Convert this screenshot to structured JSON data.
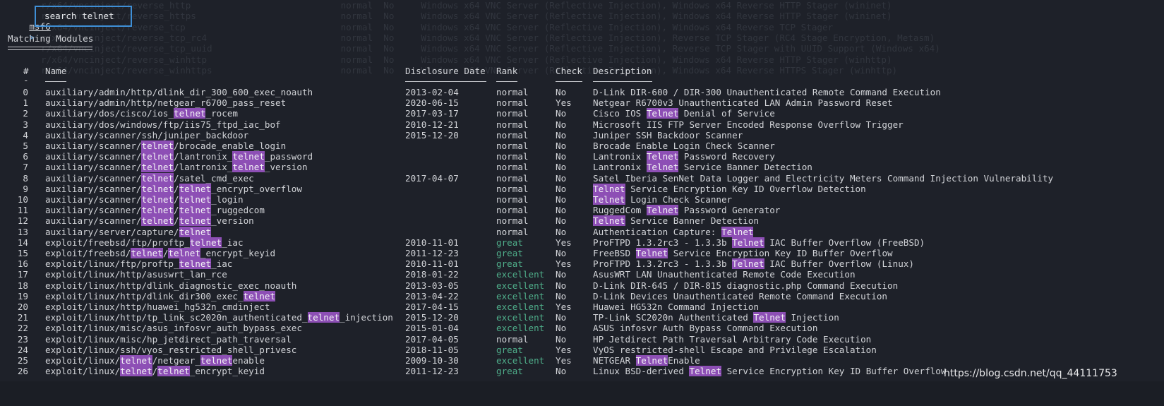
{
  "prompt": {
    "name": "msf6",
    "arrow": ">",
    "command": "search telnet"
  },
  "section_title": "Matching Modules",
  "columns": {
    "num": "#",
    "name": "Name",
    "date": "Disclosure Date",
    "rank": "Rank",
    "check": "Check",
    "description": "Description",
    "num_rule": "-"
  },
  "highlight_term": "telnet",
  "rows": [
    {
      "num": "0",
      "name": "auxiliary/admin/http/dlink_dir_300_600_exec_noauth",
      "date": "2013-02-04",
      "rank": "normal",
      "check": "No",
      "description": "D-Link DIR-600 / DIR-300 Unauthenticated Remote Command Execution"
    },
    {
      "num": "1",
      "name": "auxiliary/admin/http/netgear_r6700_pass_reset",
      "date": "2020-06-15",
      "rank": "normal",
      "check": "Yes",
      "description": "Netgear R6700v3 Unauthenticated LAN Admin Password Reset"
    },
    {
      "num": "2",
      "name": "auxiliary/dos/cisco/ios_telnet_rocem",
      "date": "2017-03-17",
      "rank": "normal",
      "check": "No",
      "description": "Cisco IOS Telnet Denial of Service"
    },
    {
      "num": "3",
      "name": "auxiliary/dos/windows/ftp/iis75_ftpd_iac_bof",
      "date": "2010-12-21",
      "rank": "normal",
      "check": "No",
      "description": "Microsoft IIS FTP Server Encoded Response Overflow Trigger"
    },
    {
      "num": "4",
      "name": "auxiliary/scanner/ssh/juniper_backdoor",
      "date": "2015-12-20",
      "rank": "normal",
      "check": "No",
      "description": "Juniper SSH Backdoor Scanner"
    },
    {
      "num": "5",
      "name": "auxiliary/scanner/telnet/brocade_enable_login",
      "date": "",
      "rank": "normal",
      "check": "No",
      "description": "Brocade Enable Login Check Scanner"
    },
    {
      "num": "6",
      "name": "auxiliary/scanner/telnet/lantronix_telnet_password",
      "date": "",
      "rank": "normal",
      "check": "No",
      "description": "Lantronix Telnet Password Recovery"
    },
    {
      "num": "7",
      "name": "auxiliary/scanner/telnet/lantronix_telnet_version",
      "date": "",
      "rank": "normal",
      "check": "No",
      "description": "Lantronix Telnet Service Banner Detection"
    },
    {
      "num": "8",
      "name": "auxiliary/scanner/telnet/satel_cmd_exec",
      "date": "2017-04-07",
      "rank": "normal",
      "check": "No",
      "description": "Satel Iberia SenNet Data Logger and Electricity Meters Command Injection Vulnerability"
    },
    {
      "num": "9",
      "name": "auxiliary/scanner/telnet/telnet_encrypt_overflow",
      "date": "",
      "rank": "normal",
      "check": "No",
      "description": "Telnet Service Encryption Key ID Overflow Detection"
    },
    {
      "num": "10",
      "name": "auxiliary/scanner/telnet/telnet_login",
      "date": "",
      "rank": "normal",
      "check": "No",
      "description": "Telnet Login Check Scanner"
    },
    {
      "num": "11",
      "name": "auxiliary/scanner/telnet/telnet_ruggedcom",
      "date": "",
      "rank": "normal",
      "check": "No",
      "description": "RuggedCom Telnet Password Generator"
    },
    {
      "num": "12",
      "name": "auxiliary/scanner/telnet/telnet_version",
      "date": "",
      "rank": "normal",
      "check": "No",
      "description": "Telnet Service Banner Detection"
    },
    {
      "num": "13",
      "name": "auxiliary/server/capture/telnet",
      "date": "",
      "rank": "normal",
      "check": "No",
      "description": "Authentication Capture: Telnet"
    },
    {
      "num": "14",
      "name": "exploit/freebsd/ftp/proftp_telnet_iac",
      "date": "2010-11-01",
      "rank": "great",
      "check": "Yes",
      "description": "ProFTPD 1.3.2rc3 - 1.3.3b Telnet IAC Buffer Overflow (FreeBSD)"
    },
    {
      "num": "15",
      "name": "exploit/freebsd/telnet/telnet_encrypt_keyid",
      "date": "2011-12-23",
      "rank": "great",
      "check": "No",
      "description": "FreeBSD Telnet Service Encryption Key ID Buffer Overflow"
    },
    {
      "num": "16",
      "name": "exploit/linux/ftp/proftp_telnet_iac",
      "date": "2010-11-01",
      "rank": "great",
      "check": "Yes",
      "description": "ProFTPD 1.3.2rc3 - 1.3.3b Telnet IAC Buffer Overflow (Linux)"
    },
    {
      "num": "17",
      "name": "exploit/linux/http/asuswrt_lan_rce",
      "date": "2018-01-22",
      "rank": "excellent",
      "check": "No",
      "description": "AsusWRT LAN Unauthenticated Remote Code Execution"
    },
    {
      "num": "18",
      "name": "exploit/linux/http/dlink_diagnostic_exec_noauth",
      "date": "2013-03-05",
      "rank": "excellent",
      "check": "No",
      "description": "D-Link DIR-645 / DIR-815 diagnostic.php Command Execution"
    },
    {
      "num": "19",
      "name": "exploit/linux/http/dlink_dir300_exec_telnet",
      "date": "2013-04-22",
      "rank": "excellent",
      "check": "No",
      "description": "D-Link Devices Unauthenticated Remote Command Execution"
    },
    {
      "num": "20",
      "name": "exploit/linux/http/huawei_hg532n_cmdinject",
      "date": "2017-04-15",
      "rank": "excellent",
      "check": "Yes",
      "description": "Huawei HG532n Command Injection"
    },
    {
      "num": "21",
      "name": "exploit/linux/http/tp_link_sc2020n_authenticated_telnet_injection",
      "date": "2015-12-20",
      "rank": "excellent",
      "check": "No",
      "description": "TP-Link SC2020n Authenticated Telnet Injection"
    },
    {
      "num": "22",
      "name": "exploit/linux/misc/asus_infosvr_auth_bypass_exec",
      "date": "2015-01-04",
      "rank": "excellent",
      "check": "No",
      "description": "ASUS infosvr Auth Bypass Command Execution"
    },
    {
      "num": "23",
      "name": "exploit/linux/misc/hp_jetdirect_path_traversal",
      "date": "2017-04-05",
      "rank": "normal",
      "check": "No",
      "description": "HP Jetdirect Path Traversal Arbitrary Code Execution"
    },
    {
      "num": "24",
      "name": "exploit/linux/ssh/vyos_restricted_shell_privesc",
      "date": "2018-11-05",
      "rank": "great",
      "check": "Yes",
      "description": "VyOS restricted-shell Escape and Privilege Escalation"
    },
    {
      "num": "25",
      "name": "exploit/linux/telnet/netgear_telnetenable",
      "date": "2009-10-30",
      "rank": "excellent",
      "check": "Yes",
      "description": "NETGEAR TelnetEnable"
    },
    {
      "num": "26",
      "name": "exploit/linux/telnet/telnet_encrypt_keyid",
      "date": "2011-12-23",
      "rank": "great",
      "check": "No",
      "description": "Linux BSD-derived Telnet Service Encryption Key ID Buffer Overflow"
    }
  ],
  "ghost_lines": [
    "r/x64/vncinject/reverse_http                            normal  No     Windows x64 VNC Server (Reflective Injection), Windows x64 Reverse HTTP Stager (wininet)",
    "r/x64/vncinject/reverse_https                           normal  No     Windows x64 VNC Server (Reflective Injection), Windows x64 Reverse HTTP Stager (wininet)",
    "r/x64/vncinject/reverse_tcp                             normal  No     Windows x64 VNC Server (Reflective Injection), Windows x64 Reverse TCP Stager",
    "r/x64/vncinject/reverse_tcp_rc4                         normal  No     Windows x64 VNC Server (Reflective Injection), Reverse TCP Stager (RC4 Stage Encryption, Metasm)",
    "r/x64/vncinject/reverse_tcp_uuid                        normal  No     Windows x64 VNC Server (Reflective Injection), Reverse TCP Stager with UUID Support (Windows x64)",
    "r/x64/vncinject/reverse_winhttp                         normal  No     Windows x64 VNC Server (Reflective Injection), Windows x64 Reverse HTTP Stager (winhttp)",
    "r/x64/vncinject/reverse_winhttps                        normal  No     Windows x64 VNC Server (Reflective Injection), Windows x64 Reverse HTTPS Stager (winhttp)"
  ],
  "watermark": "https://blog.csdn.net/qq_44111753",
  "colors": {
    "background": "#1e2129",
    "highlight": "#8d4fb5",
    "rank_green": "#4fae8a",
    "command_box": "#3f8fd6"
  }
}
